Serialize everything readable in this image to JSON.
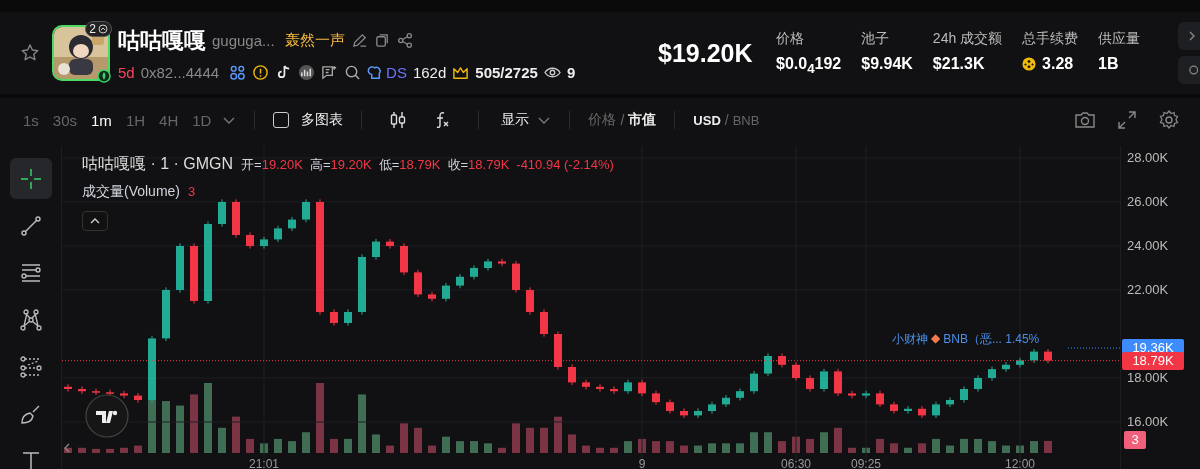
{
  "header": {
    "avatar": {
      "badge": "2"
    },
    "name": "咕咕嘎嘎",
    "ticker": "guguga...",
    "tag": "轰然一声",
    "age": "5d",
    "address": "0x82...4444",
    "dev_label": "DS",
    "dev_age": "162d",
    "rank": "505/2725",
    "watchers": "9",
    "price": "$19.20K",
    "stats": [
      {
        "label": "价格",
        "value": "$0.0$_{4}$192",
        "kind": "plain"
      },
      {
        "label": "池子",
        "value": "$9.94K",
        "kind": "plain"
      },
      {
        "label": "24h 成交额",
        "value": "$21.3K",
        "kind": "plain"
      },
      {
        "label": "总手续费",
        "value": "3.28",
        "kind": "bnb"
      },
      {
        "label": "供应量",
        "value": "1B",
        "kind": "plain"
      }
    ]
  },
  "toolbar": {
    "intervals": [
      {
        "label": "1s",
        "selected": false
      },
      {
        "label": "30s",
        "selected": false
      },
      {
        "label": "1m",
        "selected": true
      },
      {
        "label": "1H",
        "selected": false
      },
      {
        "label": "4H",
        "selected": false
      },
      {
        "label": "1D",
        "selected": false
      }
    ],
    "multi_chart": {
      "label": "多图表",
      "checked": false
    },
    "display": "显示",
    "price_mode": {
      "separator": "/",
      "options": [
        {
          "label": "价格",
          "selected": false
        },
        {
          "label": "市值",
          "selected": true
        }
      ]
    },
    "currency": {
      "separator": "/",
      "options": [
        {
          "label": "USD",
          "selected": true
        },
        {
          "label": "BNB",
          "selected": false
        }
      ]
    }
  },
  "tools": [
    {
      "kind": "crosshair",
      "selected": true
    },
    {
      "kind": "trend-line",
      "selected": false
    },
    {
      "kind": "fib",
      "selected": false
    },
    {
      "kind": "pattern",
      "selected": false
    },
    {
      "kind": "channel",
      "selected": false
    },
    {
      "kind": "brush",
      "selected": false
    },
    {
      "kind": "text",
      "selected": false
    }
  ],
  "chart": {
    "legend": {
      "symbol": "咕咕嘎嘎 · 1 · GMGN",
      "ohlc": [
        {
          "label": "开=",
          "value": "19.20K"
        },
        {
          "label": "高=",
          "value": "19.20K"
        },
        {
          "label": "低=",
          "value": "18.79K"
        },
        {
          "label": "收=",
          "value": "18.79K"
        }
      ],
      "change": "-410.94 (-2.14%)",
      "volume_label": "成交量(Volume)",
      "volume_value": "3"
    },
    "order_marker": {
      "name": "小财神",
      "symbol": "◆",
      "text": "BNB（恶... 1.45%"
    },
    "volume_badge": "3",
    "chart_data": {
      "type": "candlestick",
      "ylim": [
        13818,
        28545
      ],
      "grid": true,
      "yticks": [
        {
          "value": 16000,
          "label": "16.00K"
        },
        {
          "value": 18000,
          "label": "18.00K"
        },
        {
          "value": 22000,
          "label": "22.00K"
        },
        {
          "value": 24000,
          "label": "24.00K"
        },
        {
          "value": 26000,
          "label": "26.00K"
        },
        {
          "value": 28000,
          "label": "28.00K"
        }
      ],
      "ref_lines": [
        {
          "axis": "y",
          "value": 19360,
          "label": "19.36K",
          "color": "#3d8bfd"
        },
        {
          "axis": "y",
          "value": 18790,
          "label": "18.79K",
          "color": "#f23645"
        }
      ],
      "categories": [
        null,
        null,
        null,
        null,
        null,
        null,
        null,
        null,
        null,
        null,
        null,
        null,
        null,
        null,
        "21:01",
        null,
        null,
        null,
        null,
        null,
        null,
        null,
        null,
        null,
        null,
        null,
        null,
        null,
        null,
        null,
        null,
        null,
        null,
        null,
        null,
        null,
        null,
        null,
        null,
        null,
        null,
        "9",
        null,
        null,
        null,
        null,
        null,
        null,
        null,
        null,
        null,
        null,
        "06:30",
        null,
        null,
        null,
        null,
        "09:25",
        null,
        null,
        null,
        null,
        null,
        null,
        null,
        null,
        null,
        null,
        "12:00",
        null,
        null
      ],
      "ohlc": [
        [
          17600,
          17720,
          17380,
          17500
        ],
        [
          17500,
          17620,
          17280,
          17400
        ],
        [
          17400,
          17520,
          17230,
          17350
        ],
        [
          17350,
          17470,
          17180,
          17300
        ],
        [
          17300,
          17420,
          17080,
          17200
        ],
        [
          17200,
          17320,
          16880,
          17000
        ],
        [
          17000,
          19920,
          16880,
          19800
        ],
        [
          19800,
          22120,
          19680,
          22000
        ],
        [
          22000,
          24120,
          21880,
          24000
        ],
        [
          24000,
          24120,
          21380,
          21500
        ],
        [
          21500,
          25120,
          21380,
          25000
        ],
        [
          25000,
          26120,
          24880,
          26000
        ],
        [
          26000,
          26120,
          24380,
          24500
        ],
        [
          24500,
          24620,
          23880,
          24000
        ],
        [
          24000,
          24420,
          23880,
          24300
        ],
        [
          24300,
          24920,
          24180,
          24800
        ],
        [
          24800,
          25320,
          24680,
          25200
        ],
        [
          25200,
          26120,
          25080,
          26000
        ],
        [
          26000,
          26120,
          20880,
          21000
        ],
        [
          21000,
          21120,
          20380,
          20500
        ],
        [
          20500,
          21120,
          20380,
          21000
        ],
        [
          21000,
          23620,
          20880,
          23500
        ],
        [
          23500,
          24320,
          23380,
          24200
        ],
        [
          24200,
          24320,
          23880,
          24000
        ],
        [
          24000,
          24120,
          22680,
          22800
        ],
        [
          22800,
          22920,
          21680,
          21800
        ],
        [
          21800,
          21920,
          21480,
          21600
        ],
        [
          21600,
          22320,
          21480,
          22200
        ],
        [
          22200,
          22720,
          22080,
          22600
        ],
        [
          22600,
          23120,
          22480,
          23000
        ],
        [
          23000,
          23420,
          22880,
          23300
        ],
        [
          23300,
          23420,
          23080,
          23200
        ],
        [
          23200,
          23320,
          21880,
          22000
        ],
        [
          22000,
          22120,
          20880,
          21000
        ],
        [
          21000,
          21120,
          19880,
          20000
        ],
        [
          20000,
          20120,
          18380,
          18500
        ],
        [
          18500,
          18620,
          17680,
          17800
        ],
        [
          17800,
          17920,
          17480,
          17600
        ],
        [
          17600,
          17720,
          17380,
          17500
        ],
        [
          17500,
          17620,
          17280,
          17400
        ],
        [
          17400,
          17920,
          17280,
          17800
        ],
        [
          17800,
          17920,
          17180,
          17300
        ],
        [
          17300,
          17420,
          16780,
          16900
        ],
        [
          16900,
          17020,
          16380,
          16500
        ],
        [
          16500,
          16620,
          16180,
          16300
        ],
        [
          16300,
          16620,
          16180,
          16500
        ],
        [
          16500,
          16920,
          16380,
          16800
        ],
        [
          16800,
          17220,
          16680,
          17100
        ],
        [
          17100,
          17520,
          16980,
          17400
        ],
        [
          17400,
          18320,
          17280,
          18200
        ],
        [
          18200,
          19120,
          18080,
          19000
        ],
        [
          19000,
          19120,
          18480,
          18600
        ],
        [
          18600,
          18720,
          17880,
          18000
        ],
        [
          18000,
          18120,
          17380,
          17500
        ],
        [
          17500,
          18420,
          17380,
          18300
        ],
        [
          18300,
          18420,
          17180,
          17300
        ],
        [
          17300,
          17420,
          17080,
          17200
        ],
        [
          17200,
          17420,
          17080,
          17300
        ],
        [
          17300,
          17420,
          16680,
          16800
        ],
        [
          16800,
          16920,
          16380,
          16500
        ],
        [
          16500,
          16720,
          16380,
          16600
        ],
        [
          16600,
          16720,
          16180,
          16300
        ],
        [
          16300,
          16920,
          16180,
          16800
        ],
        [
          16800,
          17120,
          16680,
          17000
        ],
        [
          17000,
          17620,
          16880,
          17500
        ],
        [
          17500,
          18120,
          17380,
          18000
        ],
        [
          18000,
          18520,
          17880,
          18400
        ],
        [
          18400,
          18720,
          18280,
          18600
        ],
        [
          18600,
          18920,
          18480,
          18800
        ],
        [
          18800,
          19320,
          18680,
          19200
        ],
        [
          19200,
          19320,
          18670,
          18790
        ]
      ]
    }
  }
}
